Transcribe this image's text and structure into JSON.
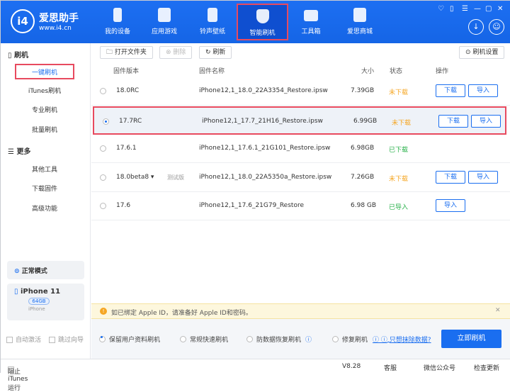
{
  "app": {
    "logo_mark": "i4",
    "name": "爱思助手",
    "url": "www.i4.cn"
  },
  "nav": [
    {
      "label": "我的设备",
      "icon": "phone-icon"
    },
    {
      "label": "应用游戏",
      "icon": "app-cube-icon"
    },
    {
      "label": "铃声壁纸",
      "icon": "music-icon"
    },
    {
      "label": "智能刷机",
      "icon": "shield-refresh-icon",
      "active": true
    },
    {
      "label": "工具箱",
      "icon": "toolbox-icon"
    },
    {
      "label": "爱思商城",
      "icon": "shopping-bag-icon"
    }
  ],
  "sidebar": {
    "group1": "刷机",
    "items1": [
      "一键刷机",
      "iTunes刷机",
      "专业刷机",
      "批量刷机"
    ],
    "group2": "更多",
    "items2": [
      "其他工具",
      "下载固件",
      "高级功能"
    ],
    "mode": "正常模式",
    "device": {
      "name": "iPhone 11",
      "storage": "64GB",
      "type": "iPhone"
    },
    "auto_activate": "自动激活",
    "skip_guide": "跳过向导"
  },
  "toolbar": {
    "open_folder": "打开文件夹",
    "delete": "删除",
    "refresh": "刷新",
    "settings": "刷机设置"
  },
  "table": {
    "headers": [
      "固件版本",
      "固件名称",
      "大小",
      "状态",
      "操作"
    ],
    "rows": [
      {
        "version": "18.0RC",
        "tag": "",
        "name": "iPhone12,1_18.0_22A3354_Restore.ipsw",
        "size": "7.39GB",
        "status": "未下载",
        "status_color": "#f5a623",
        "actions": [
          "下载",
          "导入"
        ],
        "selected": false
      },
      {
        "version": "17.7RC",
        "tag": "",
        "name": "iPhone12,1_17.7_21H16_Restore.ipsw",
        "size": "6.99GB",
        "status": "未下载",
        "status_color": "#f5a623",
        "actions": [
          "下载",
          "导入"
        ],
        "selected": true
      },
      {
        "version": "17.6.1",
        "tag": "",
        "name": "iPhone12,1_17.6.1_21G101_Restore.ipsw",
        "size": "6.98GB",
        "status": "已下载",
        "status_color": "#2bb24c",
        "actions": [],
        "selected": false
      },
      {
        "version": "18.0beta8 ▾",
        "tag": "测试版",
        "name": "iPhone12,1_18.0_22A5350a_Restore.ipsw",
        "size": "7.26GB",
        "status": "未下载",
        "status_color": "#f5a623",
        "actions": [
          "下载",
          "导入"
        ],
        "selected": false
      },
      {
        "version": "17.6",
        "tag": "",
        "name": "iPhone12,1_17.6_21G79_Restore",
        "size": "6.98 GB",
        "status": "已导入",
        "status_color": "#2bb24c",
        "actions": [
          "导入"
        ],
        "selected": false
      }
    ]
  },
  "warning": "如已绑定 Apple ID，请准备好 Apple ID和密码。",
  "options": {
    "keep_data": "保留用户资料刷机",
    "quick": "常规快速刷机",
    "anti_recovery": "防数据恢复刷机",
    "repair": "修复刷机",
    "erase_link": "只想抹除数据?",
    "flash_now": "立即刷机"
  },
  "status": {
    "block_itunes": "阻止iTunes运行",
    "version": "V8.28",
    "support": "客服",
    "wechat": "微信公众号",
    "update": "检查更新"
  },
  "colors": {
    "brand": "#1a6ef0",
    "highlight": "#e84a5f"
  }
}
